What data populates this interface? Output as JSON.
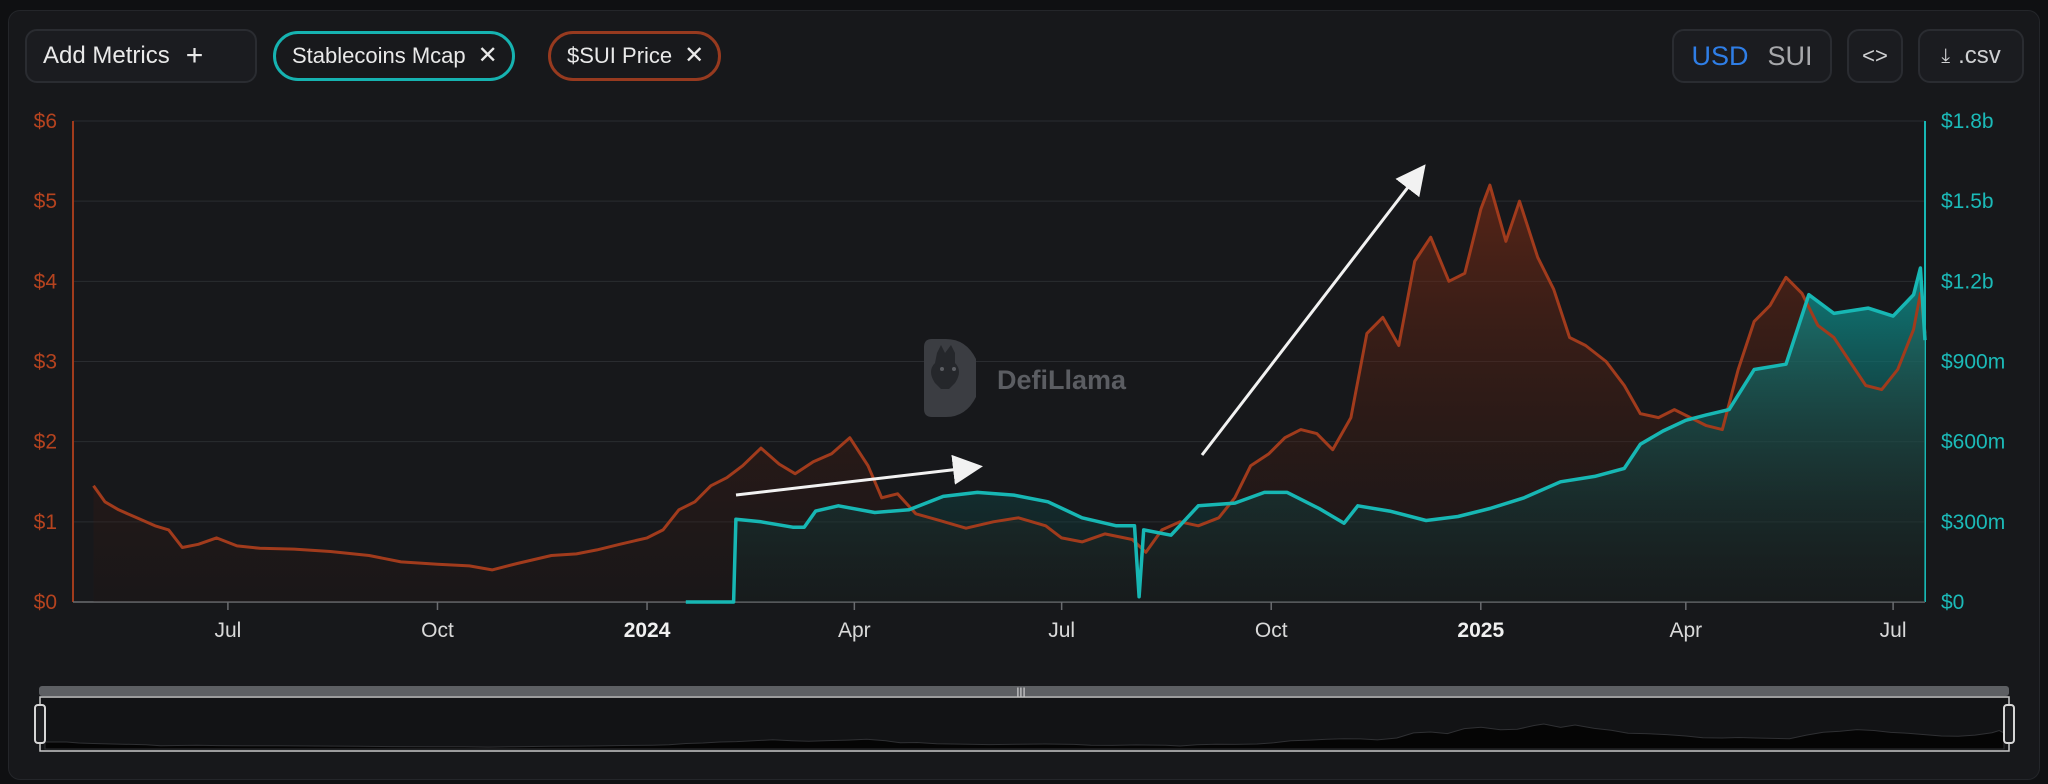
{
  "toolbar": {
    "add_metrics_label": "Add Metrics",
    "add_icon": "plus-icon",
    "chips": [
      {
        "label": "Stablecoins Mcap",
        "color": "#16b3b1",
        "close_icon": "close-icon"
      },
      {
        "label": "$SUI Price",
        "color": "#973a1f",
        "close_icon": "close-icon"
      }
    ],
    "unit_usd": "USD",
    "unit_sui": "SUI",
    "selected_unit": "USD",
    "embed_label": "<>",
    "embed_icon": "code-icon",
    "csv_label": ".csv",
    "csv_icon": "download-file-icon"
  },
  "watermark": {
    "text": "DefiLlama",
    "icon": "llama-logo-icon"
  },
  "colors": {
    "price": "#b5431f",
    "price_line": "#a13b1c",
    "stable": "#17b7b4",
    "grid": "#2a2c30",
    "accent": "#2f7ee6"
  },
  "chart_data": {
    "type": "line",
    "x_range": [
      "2023-04-24",
      "2025-07-15"
    ],
    "x_ticks": [
      {
        "date": "2023-07-01",
        "label": "Jul",
        "bold": false
      },
      {
        "date": "2023-10-01",
        "label": "Oct",
        "bold": false
      },
      {
        "date": "2024-01-01",
        "label": "2024",
        "bold": true
      },
      {
        "date": "2024-04-01",
        "label": "Apr",
        "bold": false
      },
      {
        "date": "2024-07-01",
        "label": "Jul",
        "bold": false
      },
      {
        "date": "2024-10-01",
        "label": "Oct",
        "bold": false
      },
      {
        "date": "2025-01-01",
        "label": "2025",
        "bold": true
      },
      {
        "date": "2025-04-01",
        "label": "Apr",
        "bold": false
      },
      {
        "date": "2025-07-01",
        "label": "Jul",
        "bold": false
      }
    ],
    "y_left": {
      "min": 0,
      "max": 6,
      "ticks": [
        0,
        1,
        2,
        3,
        4,
        5,
        6
      ],
      "labels": [
        "$0",
        "$1",
        "$2",
        "$3",
        "$4",
        "$5",
        "$6"
      ]
    },
    "y_right": {
      "min": 0,
      "max": 1800000000,
      "ticks": [
        0,
        300000000,
        600000000,
        900000000,
        1200000000,
        1500000000,
        1800000000
      ],
      "labels": [
        "$0",
        "$300m",
        "$600m",
        "$900m",
        "$1.2b",
        "$1.5b",
        "$1.8b"
      ]
    },
    "grid": true,
    "series": [
      {
        "name": "$SUI Price",
        "axis": "left",
        "points": [
          [
            "2023-05-03",
            1.45
          ],
          [
            "2023-05-08",
            1.25
          ],
          [
            "2023-05-14",
            1.15
          ],
          [
            "2023-05-22",
            1.05
          ],
          [
            "2023-05-30",
            0.95
          ],
          [
            "2023-06-05",
            0.9
          ],
          [
            "2023-06-11",
            0.68
          ],
          [
            "2023-06-18",
            0.72
          ],
          [
            "2023-06-26",
            0.8
          ],
          [
            "2023-07-05",
            0.7
          ],
          [
            "2023-07-15",
            0.67
          ],
          [
            "2023-07-30",
            0.66
          ],
          [
            "2023-08-15",
            0.63
          ],
          [
            "2023-09-01",
            0.58
          ],
          [
            "2023-09-15",
            0.5
          ],
          [
            "2023-10-01",
            0.47
          ],
          [
            "2023-10-15",
            0.45
          ],
          [
            "2023-10-25",
            0.4
          ],
          [
            "2023-11-05",
            0.48
          ],
          [
            "2023-11-20",
            0.58
          ],
          [
            "2023-12-01",
            0.6
          ],
          [
            "2023-12-10",
            0.65
          ],
          [
            "2023-12-20",
            0.72
          ],
          [
            "2024-01-01",
            0.8
          ],
          [
            "2024-01-08",
            0.9
          ],
          [
            "2024-01-15",
            1.15
          ],
          [
            "2024-01-22",
            1.25
          ],
          [
            "2024-01-29",
            1.45
          ],
          [
            "2024-02-05",
            1.55
          ],
          [
            "2024-02-12",
            1.7
          ],
          [
            "2024-02-20",
            1.92
          ],
          [
            "2024-02-28",
            1.72
          ],
          [
            "2024-03-06",
            1.6
          ],
          [
            "2024-03-14",
            1.75
          ],
          [
            "2024-03-22",
            1.85
          ],
          [
            "2024-03-30",
            2.05
          ],
          [
            "2024-04-07",
            1.7
          ],
          [
            "2024-04-13",
            1.3
          ],
          [
            "2024-04-20",
            1.35
          ],
          [
            "2024-04-28",
            1.1
          ],
          [
            "2024-05-08",
            1.02
          ],
          [
            "2024-05-20",
            0.92
          ],
          [
            "2024-06-01",
            1.0
          ],
          [
            "2024-06-12",
            1.05
          ],
          [
            "2024-06-24",
            0.95
          ],
          [
            "2024-07-01",
            0.8
          ],
          [
            "2024-07-10",
            0.75
          ],
          [
            "2024-07-20",
            0.85
          ],
          [
            "2024-08-01",
            0.78
          ],
          [
            "2024-08-07",
            0.62
          ],
          [
            "2024-08-14",
            0.9
          ],
          [
            "2024-08-22",
            1.0
          ],
          [
            "2024-08-30",
            0.95
          ],
          [
            "2024-09-08",
            1.05
          ],
          [
            "2024-09-15",
            1.3
          ],
          [
            "2024-09-22",
            1.7
          ],
          [
            "2024-09-30",
            1.85
          ],
          [
            "2024-10-07",
            2.05
          ],
          [
            "2024-10-14",
            2.15
          ],
          [
            "2024-10-21",
            2.1
          ],
          [
            "2024-10-28",
            1.9
          ],
          [
            "2024-11-05",
            2.3
          ],
          [
            "2024-11-12",
            3.35
          ],
          [
            "2024-11-19",
            3.55
          ],
          [
            "2024-11-26",
            3.2
          ],
          [
            "2024-12-03",
            4.25
          ],
          [
            "2024-12-10",
            4.55
          ],
          [
            "2024-12-18",
            4.0
          ],
          [
            "2024-12-25",
            4.1
          ],
          [
            "2025-01-01",
            4.9
          ],
          [
            "2025-01-05",
            5.2
          ],
          [
            "2025-01-12",
            4.5
          ],
          [
            "2025-01-18",
            5.0
          ],
          [
            "2025-01-26",
            4.3
          ],
          [
            "2025-02-02",
            3.9
          ],
          [
            "2025-02-09",
            3.3
          ],
          [
            "2025-02-16",
            3.2
          ],
          [
            "2025-02-25",
            3.0
          ],
          [
            "2025-03-05",
            2.7
          ],
          [
            "2025-03-12",
            2.35
          ],
          [
            "2025-03-20",
            2.3
          ],
          [
            "2025-03-27",
            2.4
          ],
          [
            "2025-04-03",
            2.3
          ],
          [
            "2025-04-10",
            2.2
          ],
          [
            "2025-04-17",
            2.15
          ],
          [
            "2025-04-24",
            2.9
          ],
          [
            "2025-05-01",
            3.5
          ],
          [
            "2025-05-08",
            3.7
          ],
          [
            "2025-05-15",
            4.05
          ],
          [
            "2025-05-22",
            3.85
          ],
          [
            "2025-05-29",
            3.45
          ],
          [
            "2025-06-05",
            3.3
          ],
          [
            "2025-06-12",
            3.0
          ],
          [
            "2025-06-19",
            2.7
          ],
          [
            "2025-06-26",
            2.65
          ],
          [
            "2025-07-03",
            2.9
          ],
          [
            "2025-07-10",
            3.4
          ],
          [
            "2025-07-13",
            3.85
          ],
          [
            "2025-07-15",
            3.35
          ]
        ]
      },
      {
        "name": "Stablecoins Mcap",
        "axis": "right",
        "points": [
          [
            "2024-01-18",
            0
          ],
          [
            "2024-02-08",
            0
          ],
          [
            "2024-02-09",
            310000000
          ],
          [
            "2024-02-20",
            300000000
          ],
          [
            "2024-03-05",
            280000000
          ],
          [
            "2024-03-10",
            280000000
          ],
          [
            "2024-03-15",
            340000000
          ],
          [
            "2024-03-25",
            360000000
          ],
          [
            "2024-04-10",
            335000000
          ],
          [
            "2024-04-25",
            345000000
          ],
          [
            "2024-05-10",
            395000000
          ],
          [
            "2024-05-25",
            410000000
          ],
          [
            "2024-06-10",
            400000000
          ],
          [
            "2024-06-25",
            375000000
          ],
          [
            "2024-07-10",
            315000000
          ],
          [
            "2024-07-25",
            285000000
          ],
          [
            "2024-08-02",
            285000000
          ],
          [
            "2024-08-04",
            20000000
          ],
          [
            "2024-08-06",
            270000000
          ],
          [
            "2024-08-18",
            250000000
          ],
          [
            "2024-08-30",
            360000000
          ],
          [
            "2024-09-15",
            370000000
          ],
          [
            "2024-09-28",
            410000000
          ],
          [
            "2024-10-08",
            410000000
          ],
          [
            "2024-10-22",
            350000000
          ],
          [
            "2024-11-02",
            295000000
          ],
          [
            "2024-11-08",
            360000000
          ],
          [
            "2024-11-22",
            340000000
          ],
          [
            "2024-12-08",
            305000000
          ],
          [
            "2024-12-22",
            320000000
          ],
          [
            "2025-01-05",
            350000000
          ],
          [
            "2025-01-20",
            390000000
          ],
          [
            "2025-02-05",
            450000000
          ],
          [
            "2025-02-20",
            470000000
          ],
          [
            "2025-03-05",
            500000000
          ],
          [
            "2025-03-12",
            590000000
          ],
          [
            "2025-03-22",
            640000000
          ],
          [
            "2025-04-01",
            680000000
          ],
          [
            "2025-04-10",
            700000000
          ],
          [
            "2025-04-20",
            720000000
          ],
          [
            "2025-05-01",
            870000000
          ],
          [
            "2025-05-15",
            890000000
          ],
          [
            "2025-05-25",
            1150000000
          ],
          [
            "2025-06-05",
            1080000000
          ],
          [
            "2025-06-20",
            1100000000
          ],
          [
            "2025-07-01",
            1070000000
          ],
          [
            "2025-07-10",
            1150000000
          ],
          [
            "2025-07-13",
            1250000000
          ],
          [
            "2025-07-15",
            980000000
          ]
        ]
      }
    ],
    "navigator": {
      "handle_icon": "grip-icon"
    }
  }
}
